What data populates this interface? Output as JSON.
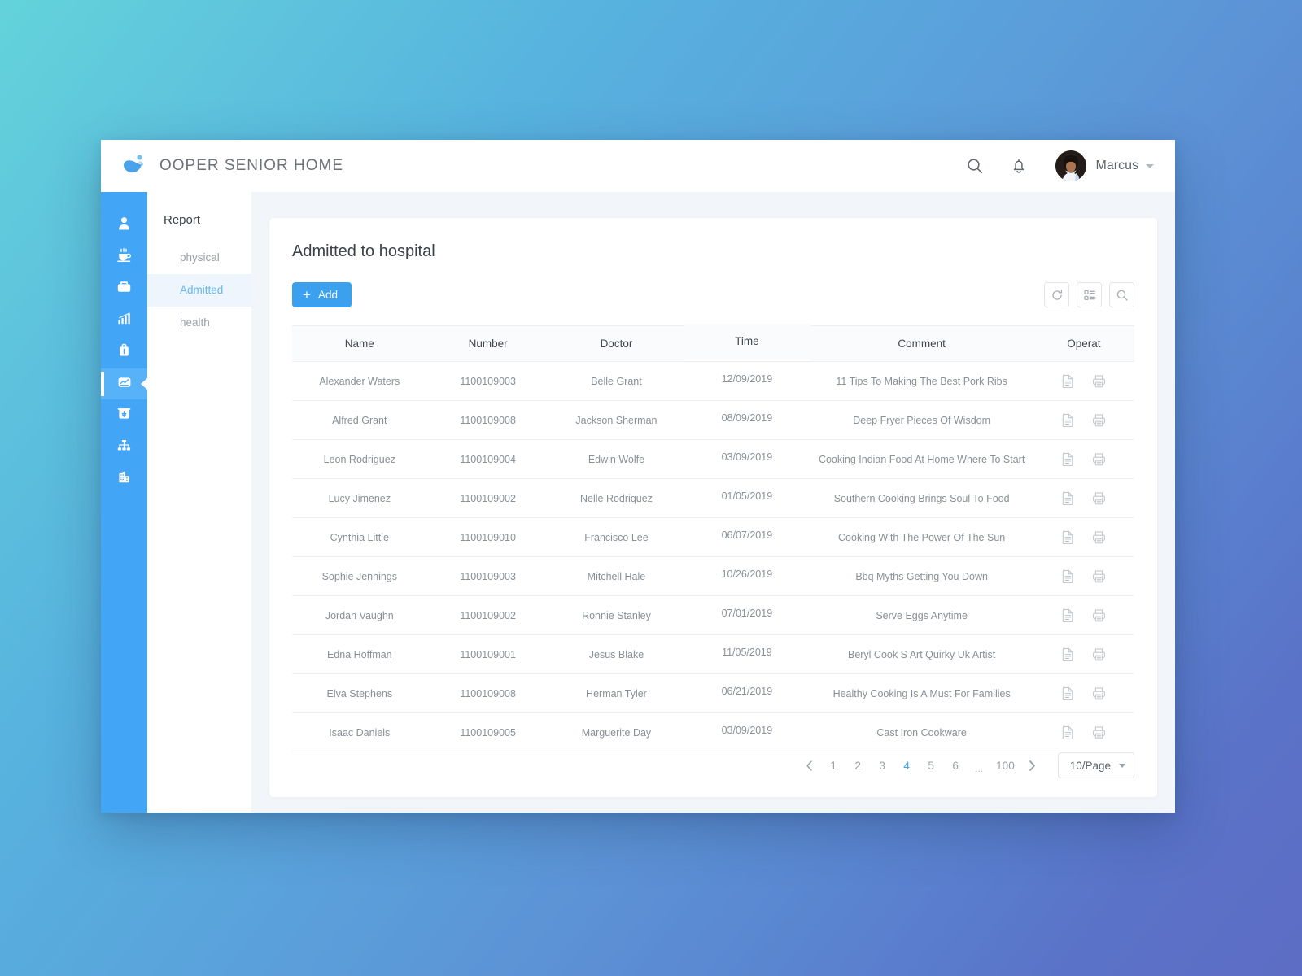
{
  "header": {
    "brand_title": "OOPER SENIOR HOME",
    "logo_icon": "water-drop-logo",
    "search_icon": "search-icon",
    "bell_icon": "bell-icon",
    "user_name": "Marcus",
    "caret_icon": "chevron-down-icon"
  },
  "rail": {
    "items": [
      {
        "icon": "user-icon",
        "active": false
      },
      {
        "icon": "coffee-cup-icon",
        "active": false
      },
      {
        "icon": "briefcase-icon",
        "active": false
      },
      {
        "icon": "bar-chart-icon",
        "active": false
      },
      {
        "icon": "suitcase-icon",
        "active": false
      },
      {
        "icon": "monitor-chart-icon",
        "active": true
      },
      {
        "icon": "medical-box-icon",
        "active": false
      },
      {
        "icon": "sitemap-icon",
        "active": false
      },
      {
        "icon": "building-icon",
        "active": false
      }
    ]
  },
  "subnav": {
    "title": "Report",
    "items": [
      {
        "label": "physical",
        "active": false
      },
      {
        "label": "Admitted",
        "active": true
      },
      {
        "label": "health",
        "active": false
      }
    ]
  },
  "main": {
    "card_title": "Admitted to hospital",
    "add_label": "Add",
    "add_plus": "+",
    "tools": [
      {
        "icon": "refresh-icon"
      },
      {
        "icon": "list-settings-icon"
      },
      {
        "icon": "search-icon"
      }
    ],
    "table": {
      "columns": [
        "Name",
        "Number",
        "Doctor",
        "Time",
        "Comment",
        "Operat"
      ],
      "row_icons": [
        "document-icon",
        "printer-icon"
      ],
      "rows": [
        {
          "name": "Alexander Waters",
          "number": "1100109003",
          "doctor": "Belle Grant",
          "time": "12/09/2019",
          "comment": "11 Tips To Making The Best Pork Ribs"
        },
        {
          "name": "Alfred Grant",
          "number": "1100109008",
          "doctor": "Jackson Sherman",
          "time": "08/09/2019",
          "comment": "Deep Fryer Pieces Of Wisdom"
        },
        {
          "name": "Leon Rodriguez",
          "number": "1100109004",
          "doctor": "Edwin Wolfe",
          "time": "03/09/2019",
          "comment": "Cooking Indian Food At Home Where To Start"
        },
        {
          "name": "Lucy Jimenez",
          "number": "1100109002",
          "doctor": "Nelle Rodriquez",
          "time": "01/05/2019",
          "comment": "Southern Cooking Brings Soul To Food"
        },
        {
          "name": "Cynthia Little",
          "number": "1100109010",
          "doctor": "Francisco Lee",
          "time": "06/07/2019",
          "comment": "Cooking With The Power Of The Sun"
        },
        {
          "name": "Sophie Jennings",
          "number": "1100109003",
          "doctor": "Mitchell Hale",
          "time": "10/26/2019",
          "comment": "Bbq Myths Getting You Down"
        },
        {
          "name": "Jordan Vaughn",
          "number": "1100109002",
          "doctor": "Ronnie Stanley",
          "time": "07/01/2019",
          "comment": "Serve Eggs Anytime"
        },
        {
          "name": "Edna Hoffman",
          "number": "1100109001",
          "doctor": "Jesus Blake",
          "time": "11/05/2019",
          "comment": "Beryl Cook S Art Quirky Uk Artist"
        },
        {
          "name": "Elva Stephens",
          "number": "1100109008",
          "doctor": "Herman Tyler",
          "time": "06/21/2019",
          "comment": "Healthy Cooking Is A Must For Families"
        },
        {
          "name": "Isaac Daniels",
          "number": "1100109005",
          "doctor": "Marguerite Day",
          "time": "03/09/2019",
          "comment": "Cast Iron Cookware"
        }
      ]
    },
    "pagination": {
      "prev_icon": "chevron-left-icon",
      "next_icon": "chevron-right-icon",
      "pages": [
        "1",
        "2",
        "3",
        "4",
        "5",
        "6"
      ],
      "active_page": "4",
      "ellipsis": "...",
      "last_page": "100",
      "page_size_label": "10/Page",
      "page_size_caret": "chevron-down-icon"
    }
  },
  "colors": {
    "accent": "#3ba1ef",
    "rail": "#42a5f5",
    "rail_active": "#57b2f7",
    "subnav_active_text": "#63b8f0",
    "subnav_active_bg": "#eef5fd",
    "canvas": "#f2f5f9"
  }
}
